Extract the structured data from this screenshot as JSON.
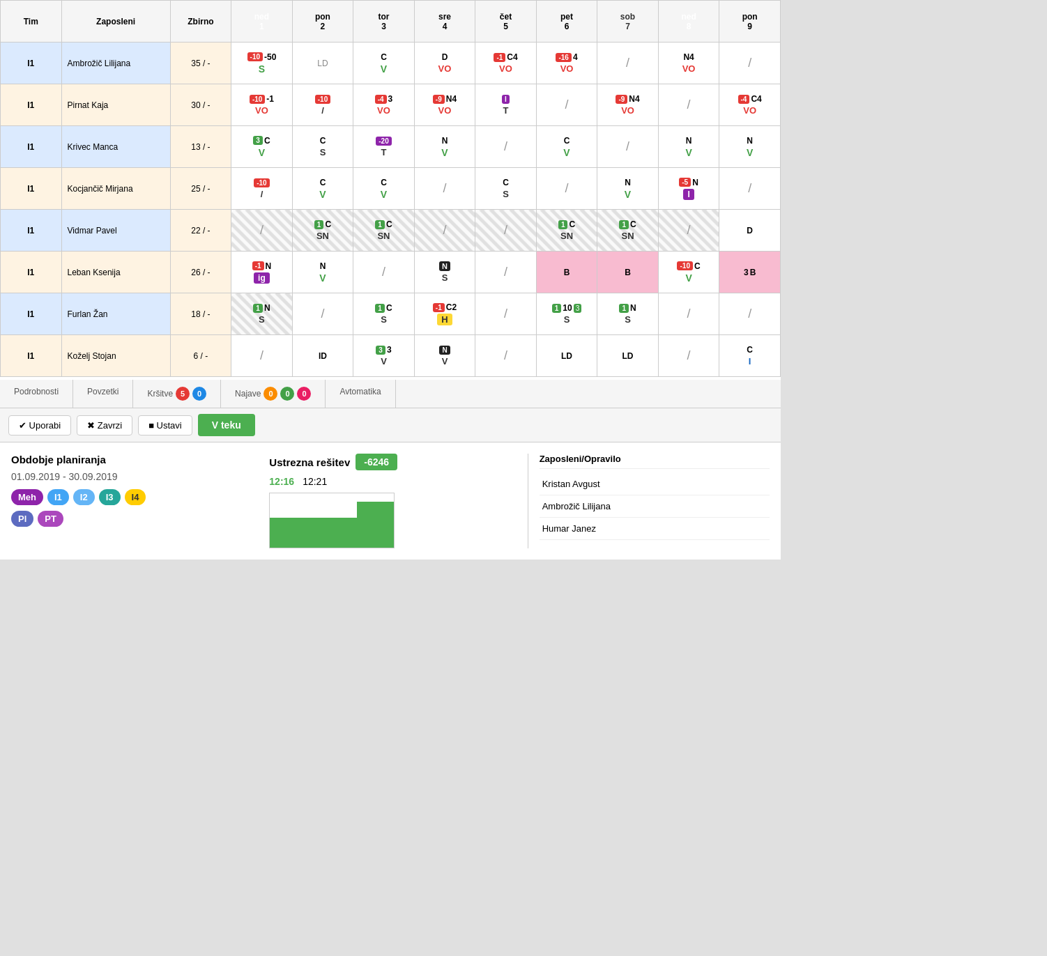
{
  "table": {
    "headers": {
      "tim": "Tim",
      "zaposleni": "Zaposleni",
      "zbirno": "Zbirno",
      "days": [
        {
          "label": "ned",
          "num": "1",
          "type": "ned"
        },
        {
          "label": "pon",
          "num": "2",
          "type": "normal"
        },
        {
          "label": "tor",
          "num": "3",
          "type": "normal"
        },
        {
          "label": "sre",
          "num": "4",
          "type": "normal"
        },
        {
          "label": "čet",
          "num": "5",
          "type": "normal"
        },
        {
          "label": "pet",
          "num": "6",
          "type": "normal"
        },
        {
          "label": "sob",
          "num": "7",
          "type": "sob"
        },
        {
          "label": "ned",
          "num": "8",
          "type": "ned"
        },
        {
          "label": "pon",
          "num": "9",
          "type": "normal"
        }
      ]
    },
    "rows": [
      {
        "tim": "I1",
        "zaposleni": "Ambrožič Lilijana",
        "zbirno": "35 / -",
        "days": [
          {
            "top": "-10",
            "top2": "-50",
            "bot": "S",
            "topColor": "red",
            "botColor": "green"
          },
          {
            "top": "LD",
            "bot": "",
            "topColor": "gray"
          },
          {
            "top": "C",
            "bot": "V",
            "botColor": "green"
          },
          {
            "top": "D",
            "bot": "VO",
            "botColor": "red-text"
          },
          {
            "top": "-1",
            "top2": "C4",
            "bot": "VO",
            "topColor": "red",
            "botColor": "red-text"
          },
          {
            "top": "-16",
            "top2": "4",
            "bot": "VO",
            "topColor": "red",
            "botColor": "red-text"
          },
          {
            "top": "/",
            "bot": ""
          },
          {
            "top": "N4",
            "bot": "VO",
            "topBg": "black",
            "botColor": "red-text"
          },
          {
            "top": "/",
            "bot": ""
          }
        ]
      },
      {
        "tim": "I1",
        "zaposleni": "Pirnat Kaja",
        "zbirno": "30 / -",
        "days": [
          {
            "top": "-10",
            "top2": "-1",
            "bot": "VO",
            "topColor": "red",
            "botColor": "red-text"
          },
          {
            "top": "-10",
            "bot": "/",
            "topColor": "red"
          },
          {
            "top": "-4",
            "top2": "3",
            "bot": "VO",
            "topColor": "red",
            "botColor": "red-text"
          },
          {
            "top": "-9",
            "top2": "N4",
            "bot": "VO",
            "topColor": "red",
            "botColor": "red-text"
          },
          {
            "top": "I",
            "bot": "T",
            "topBg": "purple"
          },
          {
            "top": "/",
            "bot": ""
          },
          {
            "top": "-9",
            "top2": "N4",
            "bot": "VO",
            "topColor": "red",
            "botColor": "red-text"
          },
          {
            "top": "/",
            "bot": ""
          },
          {
            "top": "-4",
            "top2": "C4",
            "bot": "VO",
            "topColor": "red",
            "botColor": "red-text"
          }
        ]
      },
      {
        "tim": "I1",
        "zaposleni": "Krivec Manca",
        "zbirno": "13 / -",
        "days": [
          {
            "top": "3",
            "top2": "C",
            "bot": "V",
            "topBg": "green",
            "botColor": "green"
          },
          {
            "top": "C",
            "bot": "S"
          },
          {
            "top": "-20",
            "bot": "T",
            "topBg": "purple"
          },
          {
            "top": "N",
            "bot": "V",
            "botColor": "green"
          },
          {
            "top": "/",
            "bot": ""
          },
          {
            "top": "C",
            "bot": "V",
            "botColor": "green"
          },
          {
            "top": "/",
            "bot": ""
          },
          {
            "top": "N",
            "bot": "V",
            "topBg": "black",
            "botColor": "green"
          },
          {
            "top": "N",
            "bot": "V",
            "topBg": "black",
            "botColor": "green"
          }
        ]
      },
      {
        "tim": "I1",
        "zaposleni": "Kocjančič Mirjana",
        "zbirno": "25 / -",
        "days": [
          {
            "top": "-10",
            "bot": "/",
            "topColor": "red"
          },
          {
            "top": "C",
            "bot": "V",
            "botColor": "green"
          },
          {
            "top": "C",
            "bot": "V",
            "botColor": "green"
          },
          {
            "top": "/",
            "bot": ""
          },
          {
            "top": "C",
            "bot": "S"
          },
          {
            "top": "/",
            "bot": ""
          },
          {
            "top": "N",
            "bot": "V",
            "topBg": "black",
            "botColor": "green"
          },
          {
            "top": "-5",
            "top2": "N",
            "bot": "I",
            "topColor": "red",
            "botBg": "purple"
          },
          {
            "top": "/",
            "bot": ""
          }
        ]
      },
      {
        "tim": "I1",
        "zaposleni": "Vidmar Pavel",
        "zbirno": "22 / -",
        "days": [
          {
            "striped": true,
            "top": "/"
          },
          {
            "striped": true,
            "top": "1",
            "top2": "C",
            "bot": "SN",
            "topBg": "green"
          },
          {
            "striped": true,
            "top": "1",
            "top2": "C",
            "bot": "SN",
            "topBg": "green"
          },
          {
            "striped": true,
            "top": "/"
          },
          {
            "striped": true,
            "top": "/"
          },
          {
            "striped": true,
            "top": "1",
            "top2": "C",
            "bot": "SN",
            "topBg": "green"
          },
          {
            "striped": true,
            "top": "1",
            "top2": "C",
            "bot": "SN",
            "topBg": "green"
          },
          {
            "striped": true,
            "top": "/"
          },
          {
            "top": "D",
            "bot": ""
          }
        ]
      },
      {
        "tim": "I1",
        "zaposleni": "Leban Ksenija",
        "zbirno": "26 / -",
        "days": [
          {
            "top": "-1",
            "top2": "N",
            "bot": "ig",
            "topColor": "red",
            "botBg": "purple"
          },
          {
            "top": "N",
            "bot": "V",
            "botColor": "green"
          },
          {
            "top": "/",
            "bot": ""
          },
          {
            "top2": "N",
            "bot": "S",
            "topBg": "dark"
          },
          {
            "top": "/",
            "bot": ""
          },
          {
            "top": "B",
            "bot": "",
            "cellBg": "pink"
          },
          {
            "top": "B",
            "bot": "",
            "cellBg": "pink"
          },
          {
            "top": "-10",
            "top2": "C",
            "bot": "V",
            "topColor": "red",
            "botColor": "green"
          },
          {
            "top": "3",
            "top2": "B",
            "bot": "",
            "cellBg": "pink"
          }
        ]
      },
      {
        "tim": "I1",
        "zaposleni": "Furlan Žan",
        "zbirno": "18 / -",
        "days": [
          {
            "top": "1",
            "top2": "N",
            "bot": "S",
            "topBg": "green",
            "striped": true
          },
          {
            "top": "/"
          },
          {
            "top": "1",
            "top2": "C",
            "bot": "S",
            "topBg": "green"
          },
          {
            "top": "-1",
            "top2": "C2",
            "bot": "H",
            "topColor": "red",
            "botBg": "yellow"
          },
          {
            "top": "/"
          },
          {
            "top": "1",
            "top2": "10",
            "top3": "3",
            "bot": "S",
            "topBg": "green"
          },
          {
            "top": "1",
            "top2": "N",
            "bot": "S",
            "topBg": "green"
          },
          {
            "top": "/"
          },
          {
            "top": "/"
          }
        ]
      },
      {
        "tim": "I1",
        "zaposleni": "Koželj Stojan",
        "zbirno": "6 / -",
        "days": [
          {
            "top": "/"
          },
          {
            "top": "ID"
          },
          {
            "top": "3",
            "top2": "3",
            "bot": "V",
            "topBg": "green"
          },
          {
            "top": "N",
            "bot": "V",
            "topBg": "dark"
          },
          {
            "top": "/"
          },
          {
            "top": "LD"
          },
          {
            "top": "LD"
          },
          {
            "top": "/"
          },
          {
            "top": "C",
            "bot": "I",
            "botColor": "blue"
          }
        ]
      }
    ]
  },
  "tabs": {
    "items": [
      {
        "label": "Podrobnosti",
        "active": false
      },
      {
        "label": "Povzetki",
        "active": false
      },
      {
        "label": "Kršitve",
        "active": false
      },
      {
        "label": "Najave",
        "active": false
      },
      {
        "label": "Avtomatika",
        "active": false
      }
    ],
    "krsitve_badges": [
      "5",
      "0"
    ],
    "krsitve_badge_colors": [
      "red",
      "blue"
    ],
    "najave_badges": [
      "0",
      "0",
      "0"
    ],
    "najave_badge_colors": [
      "orange",
      "green",
      "pink"
    ]
  },
  "toolbar": {
    "uporabi": "✔ Uporabi",
    "zavrzi": "✖ Zavrzi",
    "ustavi": "■ Ustavi",
    "v_teku": "V teku"
  },
  "info": {
    "obdobje_label": "Obdobje planiranja",
    "obdobje_dates": "01.09.2019 - 30.09.2019",
    "ustrezna_label": "Ustrezna rešitev",
    "ustrezna_value": "-6246",
    "time1": "12:16",
    "time2": "12:21",
    "legend": [
      {
        "label": "Meh",
        "color": "#8e24aa"
      },
      {
        "label": "I1",
        "color": "#42a5f5"
      },
      {
        "label": "I2",
        "color": "#64b5f6"
      },
      {
        "label": "I3",
        "color": "#26a69a"
      },
      {
        "label": "I4",
        "color": "#ffcc02"
      },
      {
        "label": "Pl",
        "color": "#5c6bc0"
      },
      {
        "label": "PT",
        "color": "#ab47bc"
      }
    ],
    "employees_title": "Zaposleni/Opravilo",
    "employees": [
      "Kristan Avgust",
      "Ambrožič Lilijana",
      "Humar Janez"
    ]
  }
}
